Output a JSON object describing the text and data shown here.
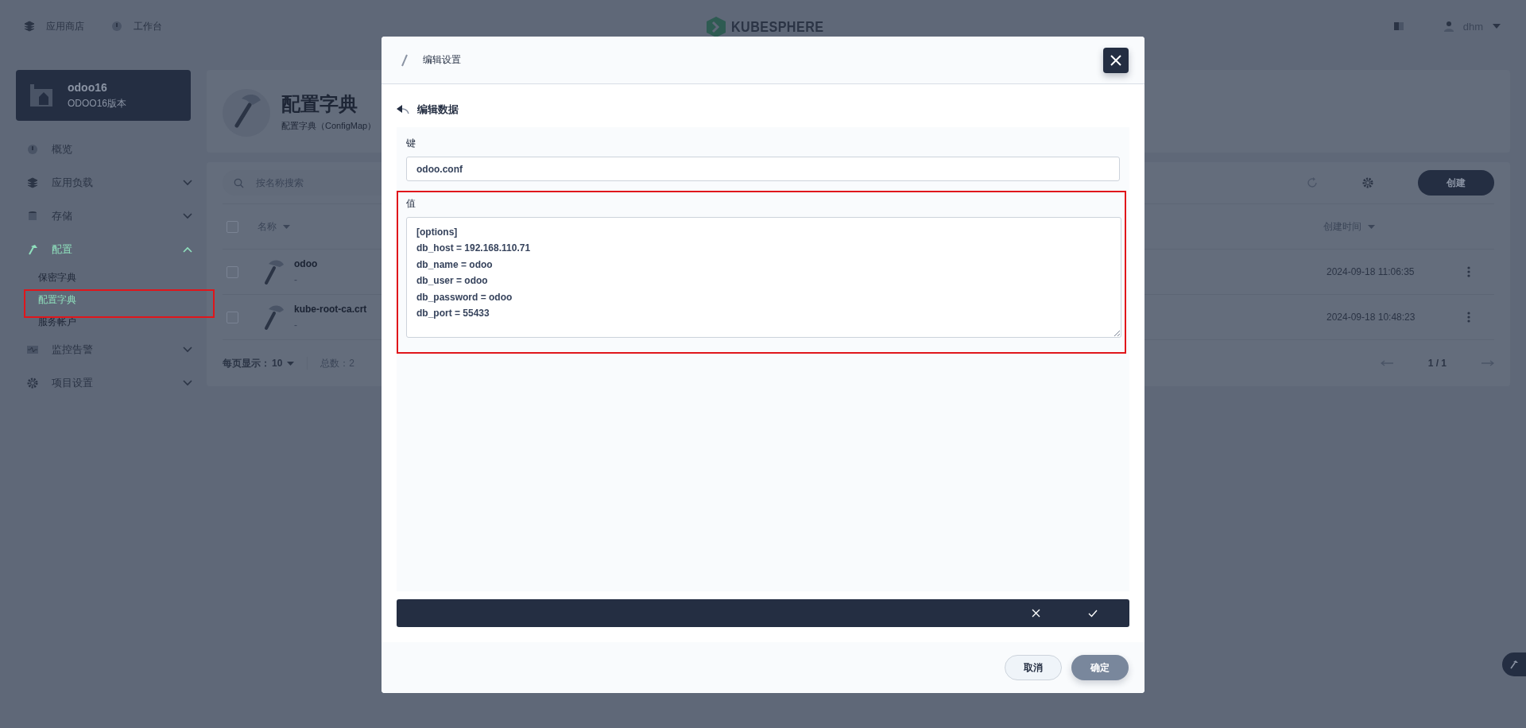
{
  "header": {
    "nav": [
      {
        "label": "应用商店"
      },
      {
        "label": "工作台"
      }
    ],
    "logo": "KUBESPHERE",
    "user": "dhm"
  },
  "sidebar": {
    "project": {
      "name": "odoo16",
      "description": "ODOO16版本"
    },
    "items": [
      {
        "label": "概览",
        "kind": "link",
        "selected": false
      },
      {
        "label": "应用负载",
        "kind": "group",
        "expanded": false,
        "selected": false
      },
      {
        "label": "存储",
        "kind": "group",
        "expanded": false,
        "selected": false
      },
      {
        "label": "配置",
        "kind": "group",
        "expanded": true,
        "selected": true,
        "children": [
          {
            "label": "保密字典",
            "selected": false
          },
          {
            "label": "配置字典",
            "selected": true
          },
          {
            "label": "服务帐户",
            "selected": false
          }
        ]
      },
      {
        "label": "监控告警",
        "kind": "group",
        "expanded": false,
        "selected": false
      },
      {
        "label": "项目设置",
        "kind": "group",
        "expanded": false,
        "selected": false
      }
    ]
  },
  "page": {
    "title": "配置字典",
    "subtitle": "配置字典（ConfigMap）"
  },
  "table": {
    "search": {
      "placeholder": "按名称搜索"
    },
    "create_button": "创建",
    "select_all_checked": false,
    "columns": [
      "名称",
      "创建时间"
    ],
    "rows": [
      {
        "name": "odoo",
        "description": "-",
        "created": "2024-09-18 11:06:35",
        "checked": false
      },
      {
        "name": "kube-root-ca.crt",
        "description": "-",
        "created": "2024-09-18 10:48:23",
        "checked": false
      }
    ],
    "footer": {
      "page_size_label": "每页显示：",
      "page_size": "10",
      "total": "总数：2",
      "pages": "1 / 1"
    }
  },
  "modal": {
    "title": "编辑设置",
    "section": "编辑数据",
    "key_label": "键",
    "key_value": "odoo.conf",
    "value_label": "值",
    "value": "[options]\ndb_host = 192.168.110.71\ndb_name = odoo\ndb_user = odoo\ndb_password = odoo\ndb_port = 55433",
    "buttons": [
      "取消",
      "确定"
    ]
  }
}
